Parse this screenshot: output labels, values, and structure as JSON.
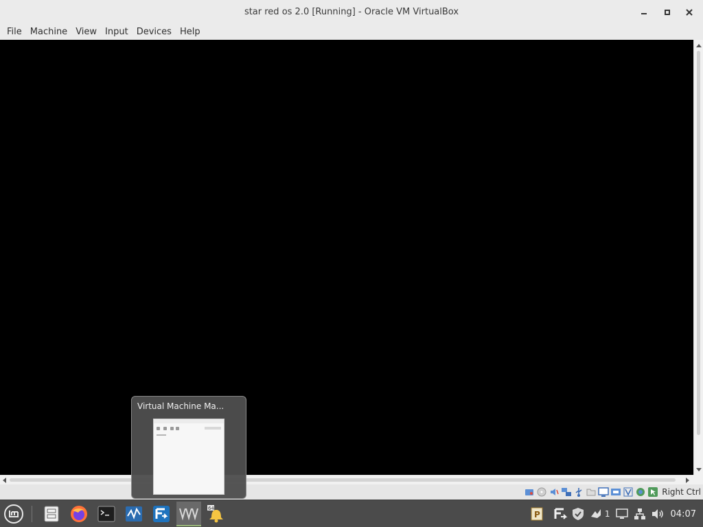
{
  "window": {
    "title": "star red os 2.0 [Running] - Oracle VM VirtualBox",
    "buttons": [
      "minimize-icon",
      "maximize-icon",
      "close-icon"
    ]
  },
  "menubar": {
    "items": [
      "File",
      "Machine",
      "View",
      "Input",
      "Devices",
      "Help"
    ]
  },
  "vm": {
    "display_color": "#000000"
  },
  "statusbar": {
    "icons": [
      "hard-disk-icon",
      "optical-disk-icon",
      "audio-icon",
      "network-icon",
      "usb-icon",
      "shared-folders-icon",
      "display-icon",
      "recording-icon",
      "virtualization-icon",
      "cpu-icon",
      "mouse-integration-icon"
    ],
    "host_key": "Right Ctrl"
  },
  "thumbnail_popup": {
    "title": "Virtual Machine Ma..."
  },
  "taskbar": {
    "apps": [
      "mint-menu-icon",
      "file-manager-icon",
      "firefox-icon",
      "terminal-icon",
      "system-monitor-icon",
      "freefilesync-icon",
      "virtualbox-icon",
      "notification-bell-icon"
    ],
    "tray_icons": [
      "pdf-applet-icon",
      "sync-icon",
      "shield-icon",
      "updates-icon",
      "display-tray-icon",
      "network-tray-icon",
      "volume-icon"
    ],
    "updates_count": "1",
    "clock": "04:07"
  },
  "colors": {
    "titlebar": "#ebebeb",
    "taskbar": "#4b4b4b",
    "accent_green": "#8fbf5c"
  }
}
